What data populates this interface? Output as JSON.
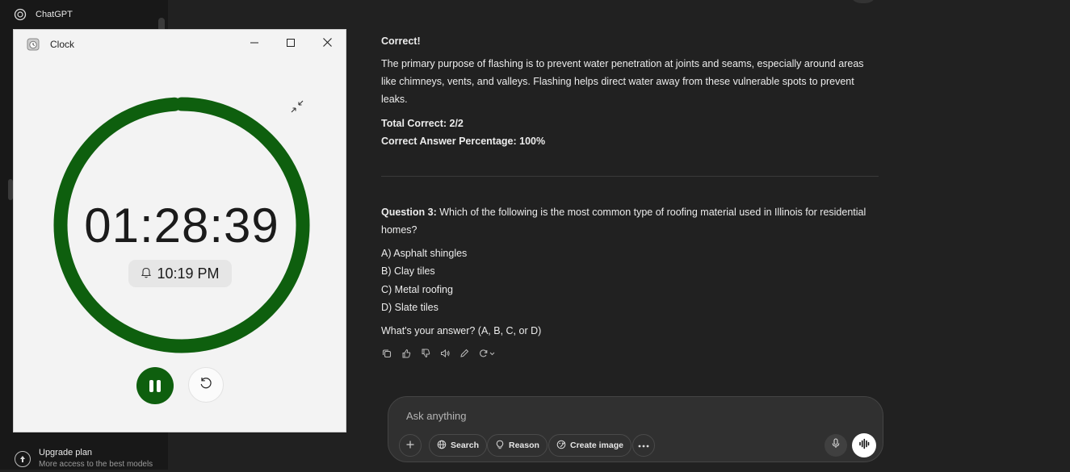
{
  "sidebar": {
    "app_name": "ChatGPT",
    "upgrade_title": "Upgrade plan",
    "upgrade_subtitle": "More access to the best models"
  },
  "clock": {
    "window_title": "Clock",
    "time_remaining": "01:28:39",
    "alarm_time": "10:19 PM",
    "progress_fraction": 0.99,
    "accent_color": "#0e5f0e",
    "icons": [
      "minimize-icon",
      "maximize-icon",
      "close-icon",
      "compact-overlay-icon",
      "bell-icon",
      "pause-icon",
      "reset-icon"
    ]
  },
  "chat": {
    "feedback_title": "Correct!",
    "explanation": "The primary purpose of flashing is to prevent water penetration at joints and seams, especially around areas like chimneys, vents, and valleys. Flashing helps direct water away from these vulnerable spots to prevent leaks.",
    "total_correct": "Total Correct: 2/2",
    "percentage": "Correct Answer Percentage: 100%",
    "question_label": "Question 3:",
    "question_text": " Which of the following is the most common type of roofing material used in Illinois for residential homes?",
    "options": [
      "A) Asphalt shingles",
      "B) Clay tiles",
      "C) Metal roofing",
      "D) Slate tiles"
    ],
    "prompt": "What's your answer? (A, B, C, or D)",
    "action_icons": [
      "copy-icon",
      "thumbs-up-icon",
      "thumbs-down-icon",
      "read-aloud-icon",
      "edit-icon",
      "regenerate-icon"
    ]
  },
  "composer": {
    "placeholder": "Ask anything",
    "search_label": "Search",
    "reason_label": "Reason",
    "create_image_label": "Create image"
  }
}
